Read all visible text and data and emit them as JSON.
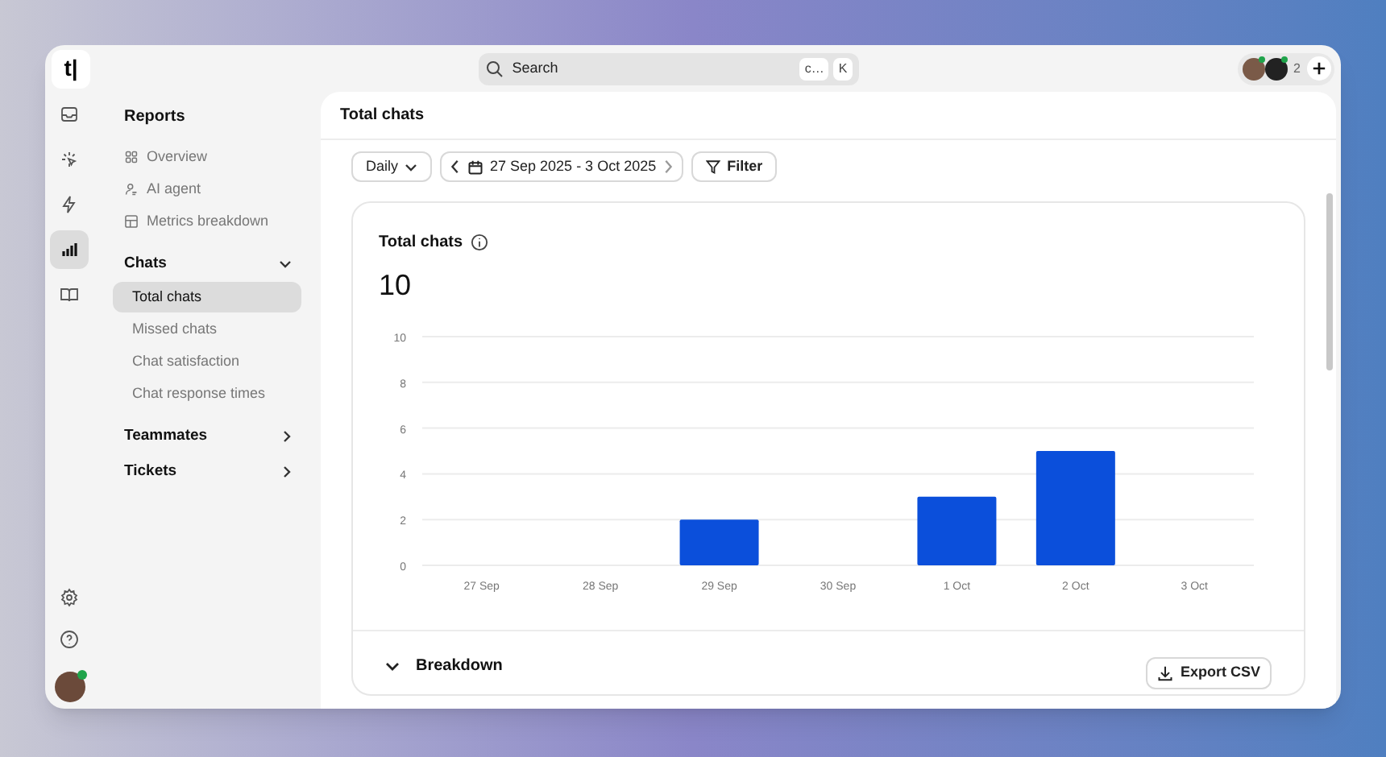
{
  "logo": "t|",
  "search": {
    "placeholder": "Search",
    "keys": [
      "c…",
      "K"
    ]
  },
  "presence": {
    "count": "2"
  },
  "rail_items": [
    {
      "selected": false
    },
    {
      "selected": false
    },
    {
      "selected": false
    },
    {
      "selected": true
    },
    {
      "selected": false
    }
  ],
  "sidebar": {
    "title": "Reports",
    "links": [
      {
        "label": "Overview",
        "selected": false
      },
      {
        "label": "AI agent",
        "selected": false
      },
      {
        "label": "Metrics breakdown",
        "selected": false
      }
    ],
    "groups": [
      {
        "label": "Chats",
        "expanded": true,
        "items": [
          {
            "label": "Total chats",
            "selected": true
          },
          {
            "label": "Missed chats",
            "selected": false
          },
          {
            "label": "Chat satisfaction",
            "selected": false
          },
          {
            "label": "Chat response times",
            "selected": false
          }
        ]
      },
      {
        "label": "Teammates",
        "expanded": false
      },
      {
        "label": "Tickets",
        "expanded": false
      }
    ]
  },
  "main": {
    "title": "Total chats",
    "toolbar": {
      "period": "Daily",
      "range": "27 Sep 2025 - 3 Oct 2025",
      "filter": "Filter"
    },
    "card": {
      "title": "Total chats",
      "total": "10",
      "chart_data": {
        "type": "bar",
        "categories": [
          "27 Sep",
          "28 Sep",
          "29 Sep",
          "30 Sep",
          "1 Oct",
          "2 Oct",
          "3 Oct"
        ],
        "series": [
          {
            "color": "#0b4fdb",
            "values": [
              0,
              0,
              2,
              0,
              3,
              5,
              0
            ]
          }
        ],
        "ylim": [
          0,
          10
        ],
        "yticks": [
          0,
          2,
          4,
          6,
          8,
          10
        ],
        "grid": true
      }
    },
    "breakdown": {
      "label": "Breakdown",
      "expanded": true,
      "export": "Export CSV"
    }
  }
}
